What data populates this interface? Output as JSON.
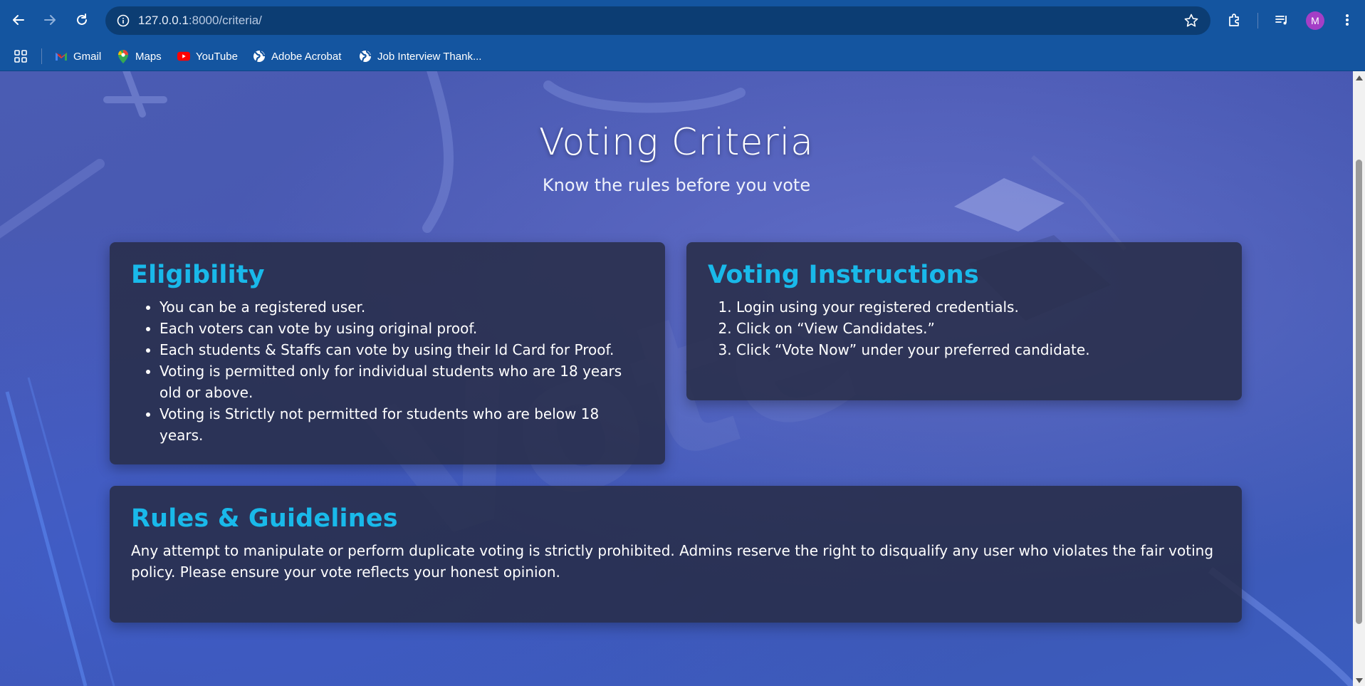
{
  "browser": {
    "url_host": "127.0.0.1",
    "url_path": ":8000/criteria/",
    "profile_initial": "M",
    "bookmarks": [
      {
        "label": "Gmail",
        "icon": "gmail-icon"
      },
      {
        "label": "Maps",
        "icon": "maps-icon"
      },
      {
        "label": "YouTube",
        "icon": "youtube-icon"
      },
      {
        "label": "Adobe Acrobat",
        "icon": "globe-icon"
      },
      {
        "label": "Job Interview Thank...",
        "icon": "globe-icon"
      }
    ],
    "colors": {
      "toolbar": "#1455a0",
      "omnibox": "#0c3d73",
      "avatar": "#a43ec6"
    }
  },
  "page": {
    "title": "Voting Criteria",
    "subtitle": "Know the rules before you vote",
    "accent_color": "#19b9ea",
    "eligibility": {
      "heading": "Eligibility",
      "items": [
        "You can be a registered user.",
        "Each voters can vote by using original proof.",
        "Each students & Staffs can vote by using their Id Card for Proof.",
        "Voting is permitted only for individual students who are 18 years old or above.",
        "Voting is Strictly not permitted for students who are below 18 years."
      ]
    },
    "instructions": {
      "heading": "Voting Instructions",
      "steps": [
        "Login using your registered credentials.",
        "Click on “View Candidates.”",
        "Click “Vote Now” under your preferred candidate."
      ]
    },
    "rules": {
      "heading": "Rules & Guidelines",
      "text": "Any attempt to manipulate or perform duplicate voting is strictly prohibited. Admins reserve the right to disqualify any user who violates the fair voting policy. Please ensure your vote reflects your honest opinion."
    }
  }
}
